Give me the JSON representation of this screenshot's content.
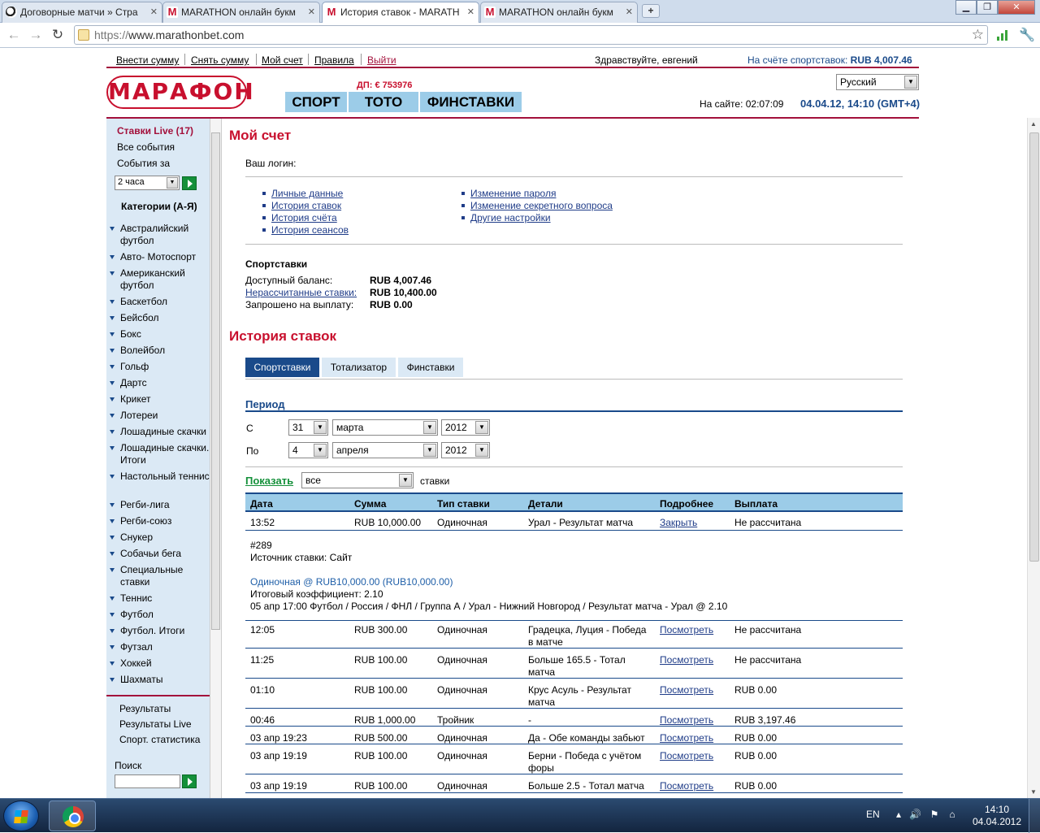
{
  "browser": {
    "tabs": [
      {
        "title": "Договорные матчи » Стра",
        "icon": "ball"
      },
      {
        "title": "MARATHON онлайн букм",
        "icon": "m"
      },
      {
        "title": "История ставок - MARATH",
        "icon": "m"
      },
      {
        "title": "MARATHON онлайн букм",
        "icon": "m"
      }
    ],
    "new_tab": "+",
    "url_scheme": "https://",
    "url_host": "www.marathonbet.com"
  },
  "site": {
    "top_links": [
      "Внести сумму",
      "Снять сумму",
      "Мой счет",
      "Правила",
      "Выйти"
    ],
    "greeting": "Здравствуйте, евгений.",
    "balance_label": "На счёте спортставок:",
    "balance_value": "RUB 4,007.46",
    "logo": "МАРАФОН",
    "dp": "ДП: € 753976",
    "main_tabs": [
      "СПОРТ",
      "ТОТО",
      "ФИНСТАВКИ"
    ],
    "language": "Русский",
    "online_label": "На сайте: 02:07:09",
    "datetime": "04.04.12, 14:10 (GMT+4)"
  },
  "sidebar": {
    "live": "Ставки Live (17)",
    "all_events": "Все события",
    "events_for": "События за",
    "hours_select": "2 часа",
    "categories_title": "Категории (А-Я)",
    "categories": [
      "Австралийский футбол",
      "Авто- Мотоспорт",
      "Американский футбол",
      "Баскетбол",
      "Бейсбол",
      "Бокс",
      "Волейбол",
      "Гольф",
      "Дартс",
      "Крикет",
      "Лотереи",
      "Лошадиные скачки",
      "Лошадиные скачки. Итоги",
      "Настольный теннис",
      "Регби-лига",
      "Регби-союз",
      "Снукер",
      "Собачьи бега",
      "Специальные ставки",
      "Теннис",
      "Футбол",
      "Футбол. Итоги",
      "Футзал",
      "Хоккей",
      "Шахматы"
    ],
    "bottom_links": [
      "Результаты",
      "Результаты Live",
      "Спорт. статистика"
    ],
    "search_label": "Поиск"
  },
  "account": {
    "title": "Мой счет",
    "login_label": "Ваш логин:",
    "links_left": [
      "Личные данные",
      "История ставок",
      "История счёта",
      "История сеансов"
    ],
    "links_right": [
      "Изменение пароля",
      "Изменение секретного вопроса",
      "Другие настройки"
    ],
    "sport_title": "Спортставки",
    "available_label": "Доступный баланс:",
    "available_value": "RUB 4,007.46",
    "unsettled_label": "Нерассчитанные ставки:",
    "unsettled_value": "RUB 10,400.00",
    "withdraw_label": "Запрошено на выплату:",
    "withdraw_value": "RUB 0.00"
  },
  "history": {
    "title": "История ставок",
    "tabs": [
      "Спортставки",
      "Тотализатор",
      "Финставки"
    ],
    "period_label": "Период",
    "from_label": "С",
    "to_label": "По",
    "from": {
      "day": "31",
      "month": "марта",
      "year": "2012"
    },
    "to": {
      "day": "4",
      "month": "апреля",
      "year": "2012"
    },
    "show_label": "Показать",
    "show_value": "все",
    "show_suffix": "ставки",
    "columns": [
      "Дата",
      "Сумма",
      "Тип ставки",
      "Детали",
      "Подробнее",
      "Выплата"
    ],
    "first_row": {
      "date": "13:52",
      "sum": "RUB 10,000.00",
      "type": "Одиночная",
      "details": "Урал - Результат матча",
      "more": "Закрыть",
      "payout": "Не рассчитана"
    },
    "expanded": {
      "id": "#289",
      "source": "Источник ставки: Сайт",
      "bet_line": "Одиночная @ RUB10,000.00 (RUB10,000.00)",
      "coef": "Итоговый коэффициент: 2.10",
      "event": "05 апр 17:00 Футбол / Россия / ФНЛ / Группа А / Урал - Нижний Новгород / Результат матча - Урал @ 2.10"
    },
    "rows": [
      {
        "date": "12:05",
        "sum": "RUB 300.00",
        "type": "Одиночная",
        "details": [
          "Градецка, Луция - Победа",
          "в матче"
        ],
        "more": "Посмотреть",
        "payout": "Не рассчитана"
      },
      {
        "date": "11:25",
        "sum": "RUB 100.00",
        "type": "Одиночная",
        "details": [
          "Больше 165.5 - Тотал",
          "матча"
        ],
        "more": "Посмотреть",
        "payout": "Не рассчитана"
      },
      {
        "date": "01:10",
        "sum": "RUB 100.00",
        "type": "Одиночная",
        "details": [
          "Крус Асуль - Результат",
          "матча"
        ],
        "more": "Посмотреть",
        "payout": "RUB 0.00"
      },
      {
        "date": "00:46",
        "sum": "RUB 1,000.00",
        "type": "Тройник",
        "details": [
          "-"
        ],
        "more": "Посмотреть",
        "payout": "RUB 3,197.46"
      },
      {
        "date": "03 апр 19:23",
        "sum": "RUB 500.00",
        "type": "Одиночная",
        "details": [
          "Да - Обе команды забьют"
        ],
        "more": "Посмотреть",
        "payout": "RUB 0.00"
      },
      {
        "date": "03 апр 19:19",
        "sum": "RUB 100.00",
        "type": "Одиночная",
        "details": [
          "Берни - Победа с учётом",
          "форы"
        ],
        "more": "Посмотреть",
        "payout": "RUB 0.00"
      },
      {
        "date": "03 апр 19:19",
        "sum": "RUB 100.00",
        "type": "Одиночная",
        "details": [
          "Больше 2.5 - Тотал матча"
        ],
        "more": "Посмотреть",
        "payout": "RUB 0.00"
      }
    ]
  },
  "taskbar": {
    "lang": "EN",
    "time": "14:10",
    "date": "04.04.2012"
  },
  "colors": {
    "brand": "#c8102e",
    "nav_blue": "#9ccce8",
    "dark_blue": "#1a4a8a",
    "sidebar": "#dbe9f5"
  }
}
